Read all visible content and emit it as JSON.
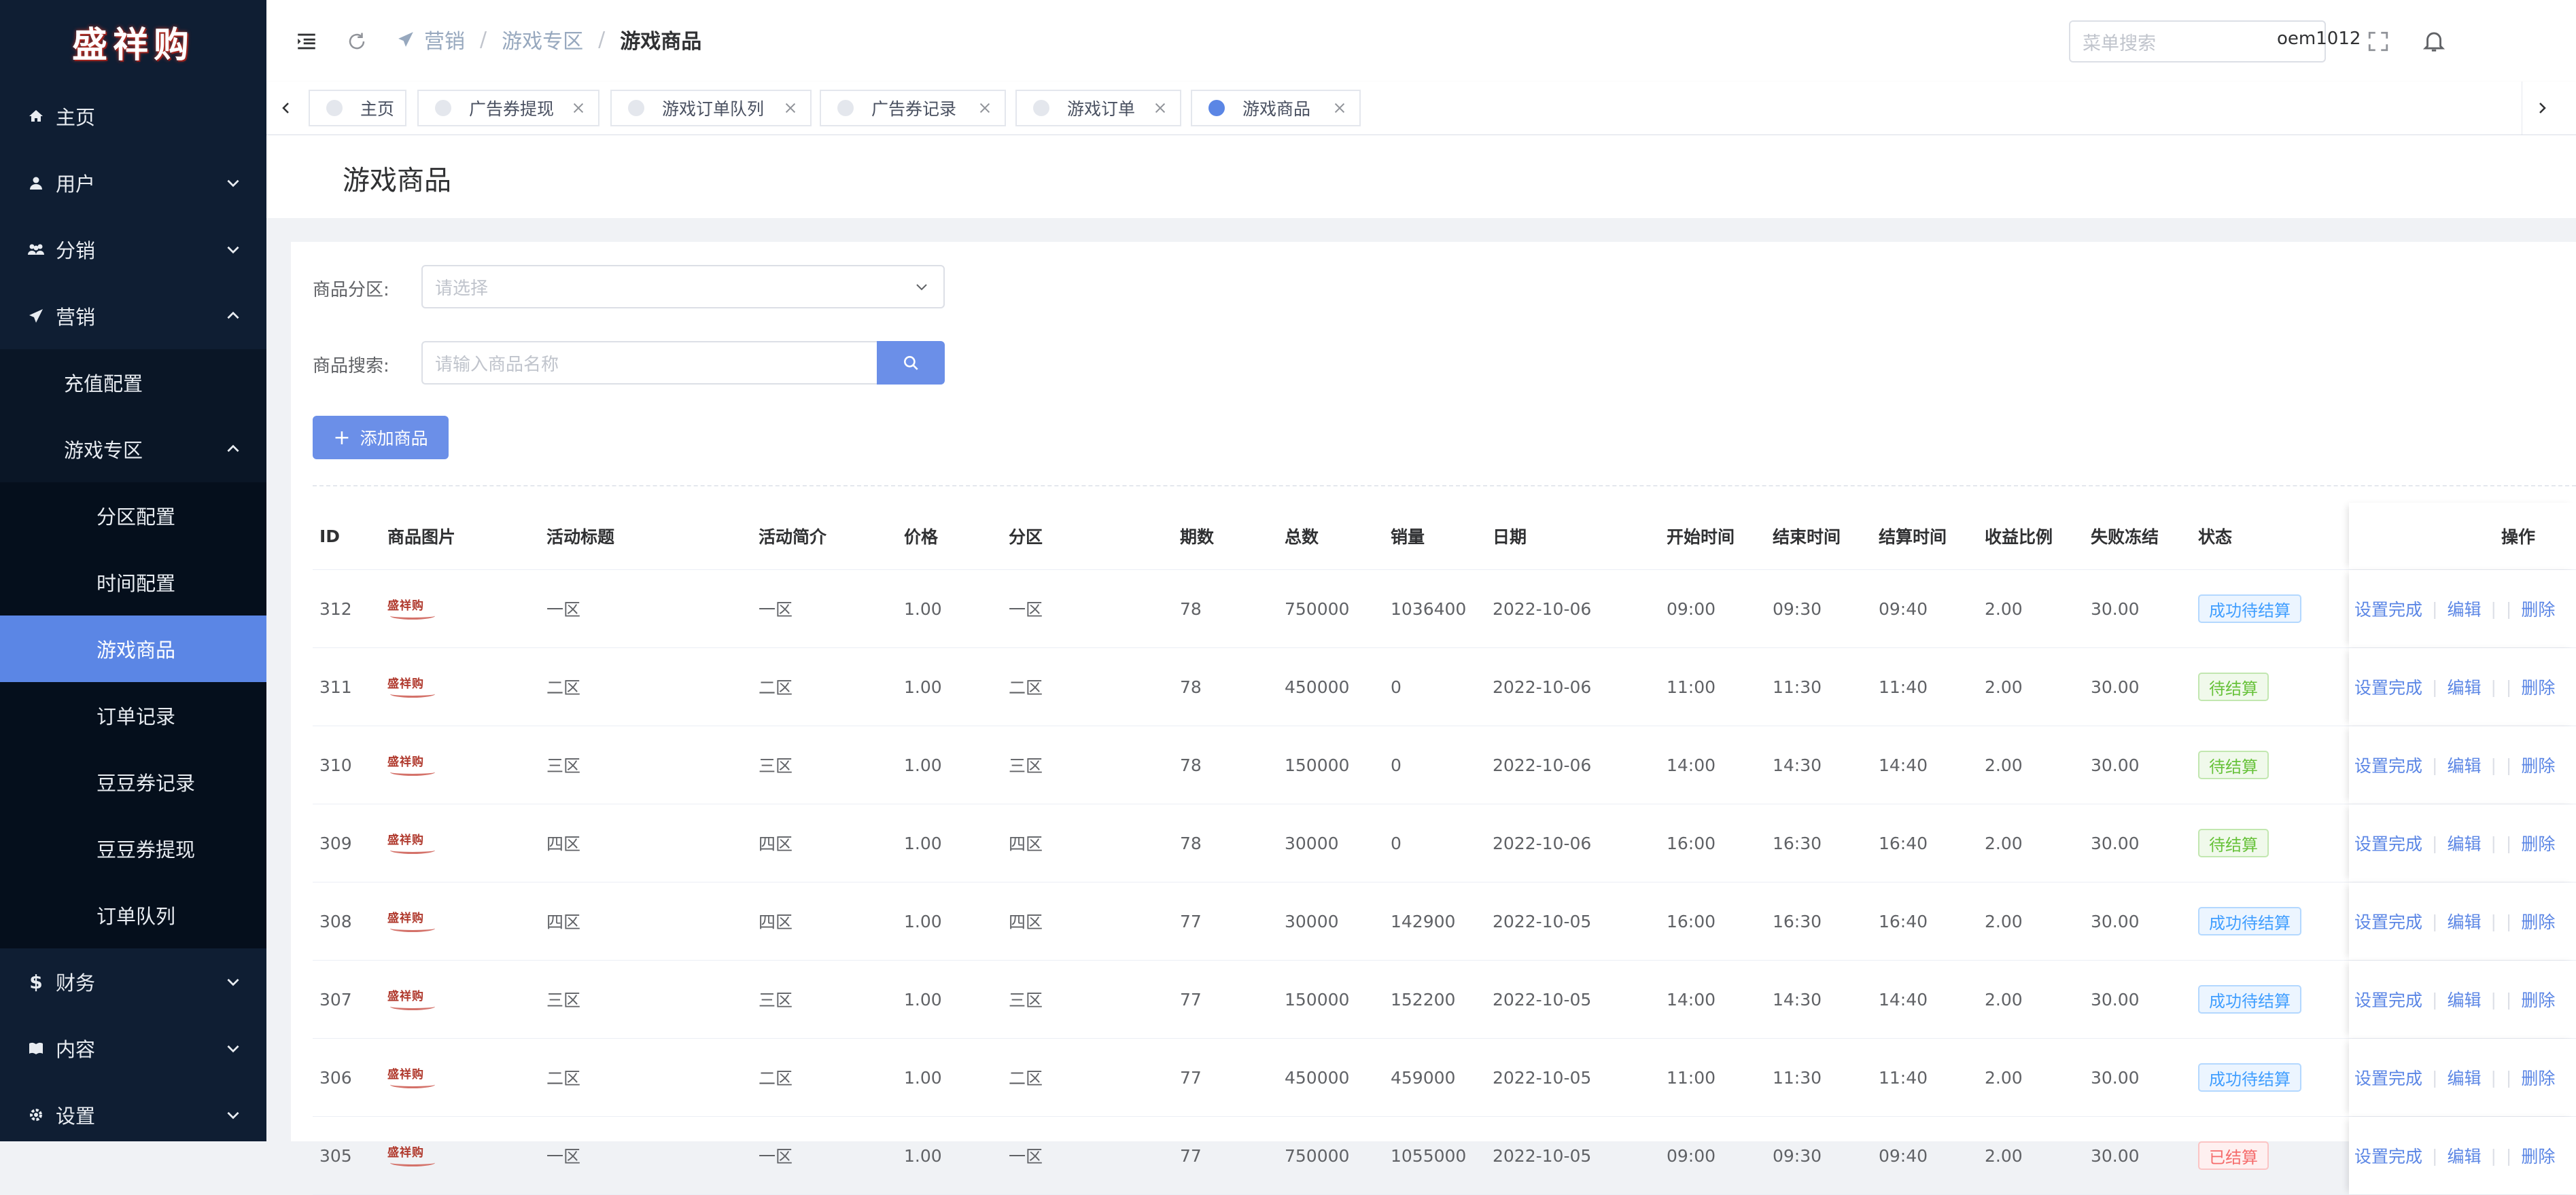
{
  "logo": {
    "text": "盛祥购"
  },
  "sidebar": {
    "home": "主页",
    "user": "用户",
    "distribution": "分销",
    "marketing": "营销",
    "marketing_sub": {
      "recharge": "充值配置",
      "game_zone": "游戏专区",
      "game_zone_items": [
        "分区配置",
        "时间配置",
        "游戏商品",
        "订单记录",
        "豆豆券记录",
        "豆豆券提现",
        "订单队列"
      ]
    },
    "finance": "财务",
    "content": "内容",
    "settings": "设置"
  },
  "header": {
    "breadcrumb": [
      "营销",
      "游戏专区",
      "游戏商品"
    ],
    "menu_search_placeholder": "菜单搜索",
    "username": "oem1012"
  },
  "tags": [
    {
      "label": "主页",
      "closable": false,
      "active": false
    },
    {
      "label": "广告券提现",
      "closable": true,
      "active": false
    },
    {
      "label": "游戏订单队列",
      "closable": true,
      "active": false
    },
    {
      "label": "广告券记录",
      "closable": true,
      "active": false
    },
    {
      "label": "游戏订单",
      "closable": true,
      "active": false
    },
    {
      "label": "游戏商品",
      "closable": true,
      "active": true
    }
  ],
  "page": {
    "title": "游戏商品"
  },
  "filters": {
    "zone_label": "商品分区:",
    "zone_placeholder": "请选择",
    "search_label": "商品搜索:",
    "search_placeholder": "请输入商品名称"
  },
  "add_button": "添加商品",
  "table": {
    "columns": [
      "ID",
      "商品图片",
      "活动标题",
      "活动简介",
      "价格",
      "分区",
      "期数",
      "总数",
      "销量",
      "日期",
      "开始时间",
      "结束时间",
      "结算时间",
      "收益比例",
      "失败冻结",
      "状态",
      "操作"
    ],
    "image_text": "盛祥购",
    "actions": {
      "complete": "设置完成",
      "edit": "编辑",
      "delete": "删除"
    },
    "rows": [
      {
        "id": "312",
        "title": "一区",
        "intro": "一区",
        "price": "1.00",
        "zone": "一区",
        "period": "78",
        "total": "750000",
        "sales": "1036400",
        "date": "2022-10-06",
        "start": "09:00",
        "end": "09:30",
        "settle": "09:40",
        "ratio": "2.00",
        "freeze": "30.00",
        "status": "成功待结算",
        "status_type": "blue"
      },
      {
        "id": "311",
        "title": "二区",
        "intro": "二区",
        "price": "1.00",
        "zone": "二区",
        "period": "78",
        "total": "450000",
        "sales": "0",
        "date": "2022-10-06",
        "start": "11:00",
        "end": "11:30",
        "settle": "11:40",
        "ratio": "2.00",
        "freeze": "30.00",
        "status": "待结算",
        "status_type": "green"
      },
      {
        "id": "310",
        "title": "三区",
        "intro": "三区",
        "price": "1.00",
        "zone": "三区",
        "period": "78",
        "total": "150000",
        "sales": "0",
        "date": "2022-10-06",
        "start": "14:00",
        "end": "14:30",
        "settle": "14:40",
        "ratio": "2.00",
        "freeze": "30.00",
        "status": "待结算",
        "status_type": "green"
      },
      {
        "id": "309",
        "title": "四区",
        "intro": "四区",
        "price": "1.00",
        "zone": "四区",
        "period": "78",
        "total": "30000",
        "sales": "0",
        "date": "2022-10-06",
        "start": "16:00",
        "end": "16:30",
        "settle": "16:40",
        "ratio": "2.00",
        "freeze": "30.00",
        "status": "待结算",
        "status_type": "green"
      },
      {
        "id": "308",
        "title": "四区",
        "intro": "四区",
        "price": "1.00",
        "zone": "四区",
        "period": "77",
        "total": "30000",
        "sales": "142900",
        "date": "2022-10-05",
        "start": "16:00",
        "end": "16:30",
        "settle": "16:40",
        "ratio": "2.00",
        "freeze": "30.00",
        "status": "成功待结算",
        "status_type": "blue"
      },
      {
        "id": "307",
        "title": "三区",
        "intro": "三区",
        "price": "1.00",
        "zone": "三区",
        "period": "77",
        "total": "150000",
        "sales": "152200",
        "date": "2022-10-05",
        "start": "14:00",
        "end": "14:30",
        "settle": "14:40",
        "ratio": "2.00",
        "freeze": "30.00",
        "status": "成功待结算",
        "status_type": "blue"
      },
      {
        "id": "306",
        "title": "二区",
        "intro": "二区",
        "price": "1.00",
        "zone": "二区",
        "period": "77",
        "total": "450000",
        "sales": "459000",
        "date": "2022-10-05",
        "start": "11:00",
        "end": "11:30",
        "settle": "11:40",
        "ratio": "2.00",
        "freeze": "30.00",
        "status": "成功待结算",
        "status_type": "blue"
      },
      {
        "id": "305",
        "title": "一区",
        "intro": "一区",
        "price": "1.00",
        "zone": "一区",
        "period": "77",
        "total": "750000",
        "sales": "1055000",
        "date": "2022-10-05",
        "start": "09:00",
        "end": "09:30",
        "settle": "09:40",
        "ratio": "2.00",
        "freeze": "30.00",
        "status": "已结算",
        "status_type": "red"
      }
    ]
  },
  "colors": {
    "sidebar_bg": "#0f1e33",
    "accent": "#5b86e5",
    "button": "#6b8fe8"
  }
}
